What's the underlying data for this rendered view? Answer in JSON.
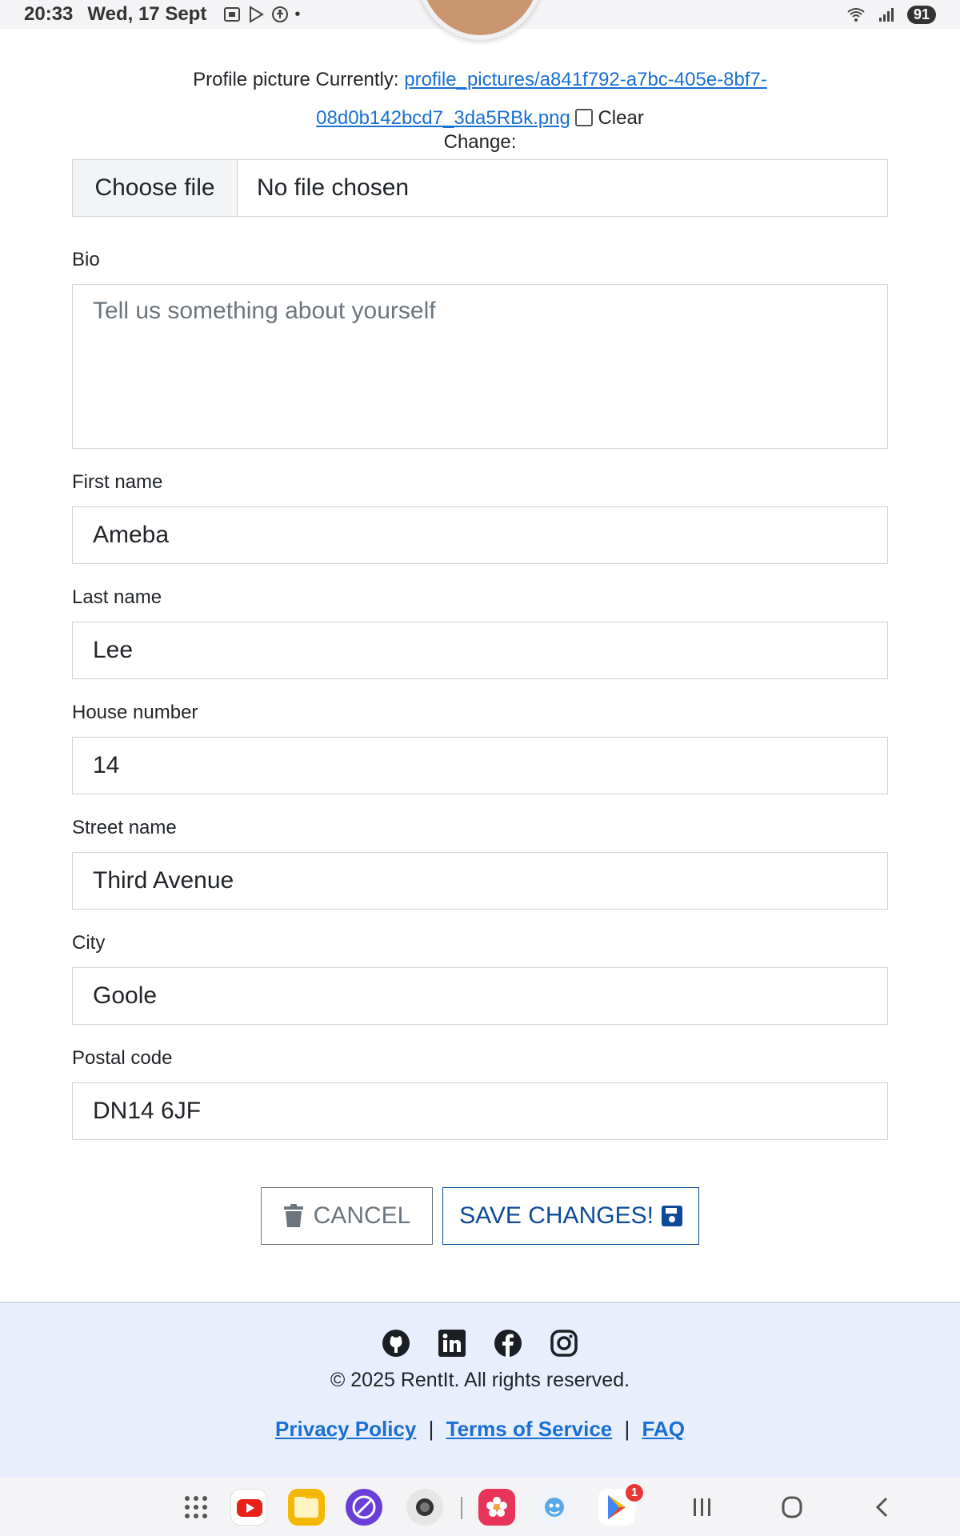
{
  "status_bar": {
    "time": "20:33",
    "date": "Wed, 17 Sept",
    "battery": "91"
  },
  "profile_picture": {
    "prefix": "Profile picture Currently:",
    "link_text_line1": "profile_pictures/a841f792-a7bc-405e-8bf7-",
    "link_text_line2": "08d0b142bcd7_3da5RBk.png",
    "clear_label": "Clear",
    "change_label": "Change:",
    "choose_file_label": "Choose file",
    "file_status": "No file chosen"
  },
  "form": {
    "bio_label": "Bio",
    "bio_placeholder": "Tell us something about yourself",
    "first_name_label": "First name",
    "first_name_value": "Ameba",
    "last_name_label": "Last name",
    "last_name_value": "Lee",
    "house_number_label": "House number",
    "house_number_value": "14",
    "street_name_label": "Street name",
    "street_name_value": "Third Avenue",
    "city_label": "City",
    "city_value": "Goole",
    "postal_code_label": "Postal code",
    "postal_code_value": "DN14 6JF"
  },
  "actions": {
    "cancel_label": "CANCEL",
    "save_label": "SAVE CHANGES!"
  },
  "footer": {
    "social_icons": [
      "github-icon",
      "linkedin-icon",
      "facebook-icon",
      "instagram-icon"
    ],
    "copyright": "© 2025 RentIt. All rights reserved.",
    "privacy_label": "Privacy Policy",
    "terms_label": "Terms of Service",
    "faq_label": "FAQ",
    "separator": "|"
  },
  "nav_bar": {
    "apps": [
      "youtube-icon",
      "files-icon",
      "browser-icon",
      "camera-icon",
      "gallery-icon",
      "game-icon",
      "play-store-icon"
    ],
    "play_store_badge": "1"
  },
  "colors": {
    "link": "#1a6fd4",
    "save_button": "#0d4a99",
    "cancel_button": "#6c757d",
    "footer_bg": "#e8eefb"
  }
}
